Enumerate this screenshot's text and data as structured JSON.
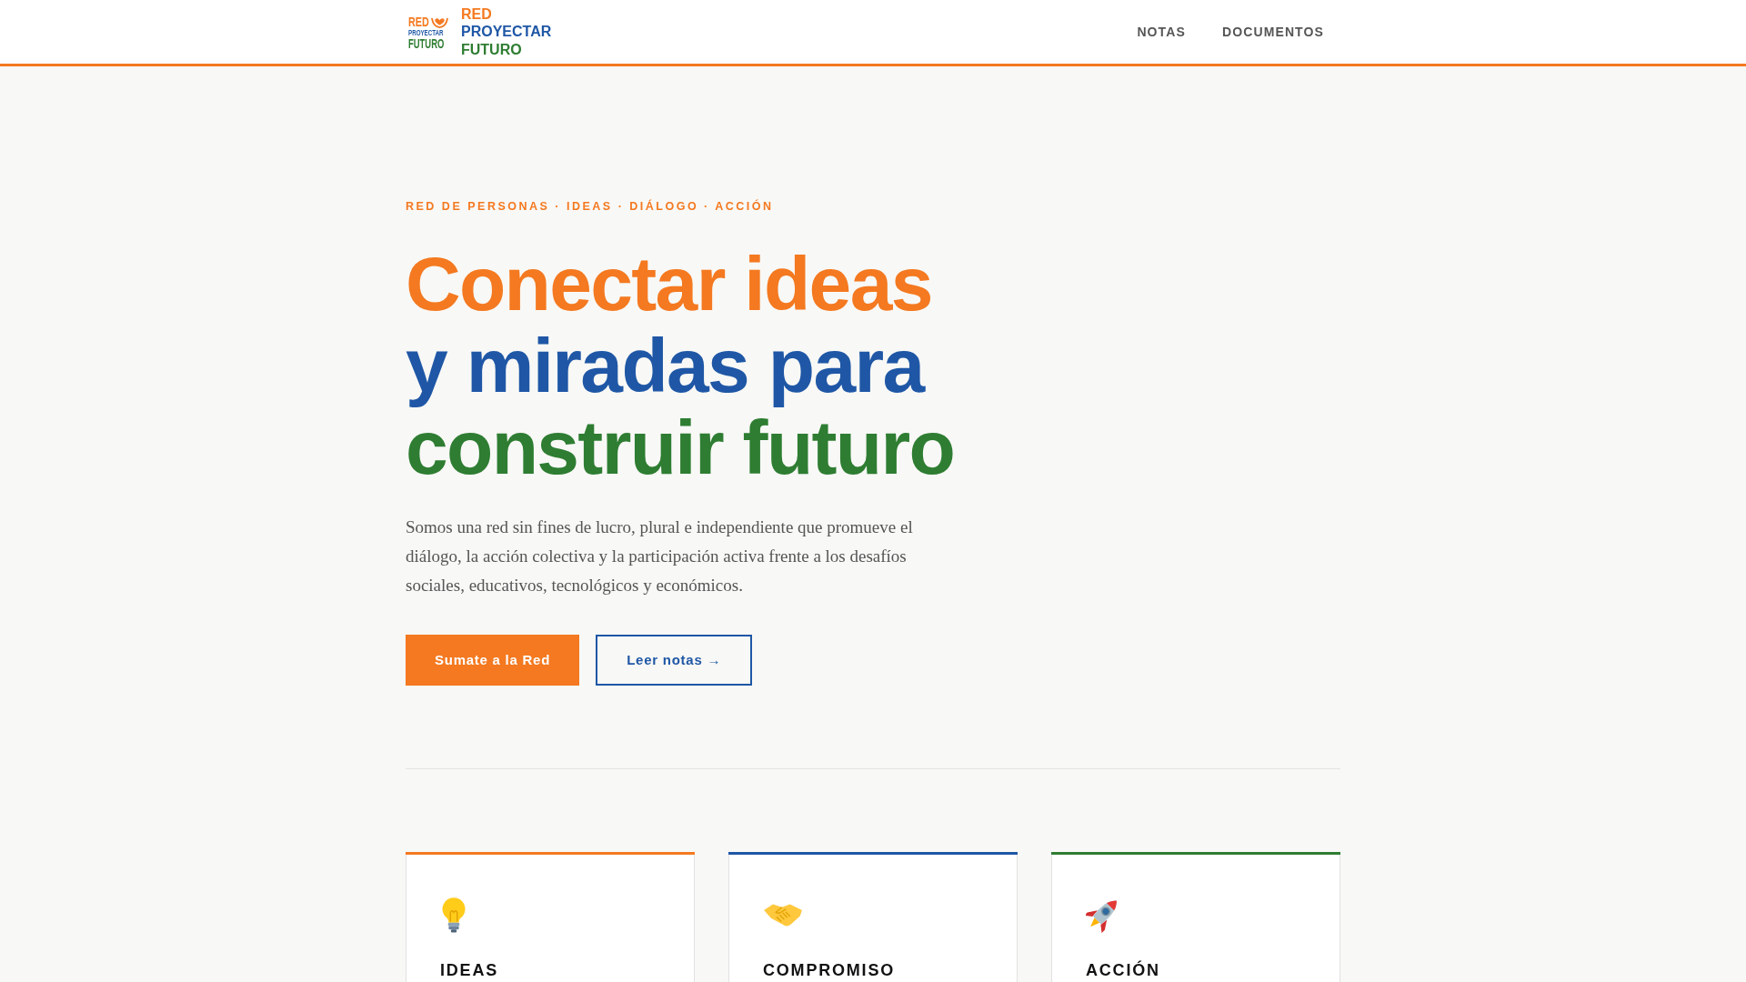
{
  "header": {
    "logo_emblem": [
      {
        "text": "RED",
        "color": "#f47920"
      },
      {
        "text": "PROYECTAR",
        "color": "#1f57a6"
      },
      {
        "text": "FUTURO",
        "color": "#2e7d32"
      }
    ],
    "logo_wordmark": [
      {
        "text": "RED",
        "color": "#f47920"
      },
      {
        "text": "PROYECTAR",
        "color": "#1f57a6"
      },
      {
        "text": "FUTURO",
        "color": "#2e7d32"
      }
    ],
    "nav": [
      "NOTAS",
      "DOCUMENTOS"
    ]
  },
  "hero": {
    "eyebrow": "RED DE PERSONAS · IDEAS · DIÁLOGO · ACCIÓN",
    "heading_lines": [
      {
        "text": "Conectar ideas",
        "color": "#f47920"
      },
      {
        "text": "y miradas para",
        "color": "#1f57a6"
      },
      {
        "text": "construir futuro",
        "color": "#2e7d32"
      }
    ],
    "description": "Somos una red sin fines de lucro, plural e independiente que promueve el diálogo, la acción colectiva y la participación activa frente a los desafíos sociales, educativos, tecnológicos y económicos.",
    "buttons": [
      {
        "label": "Sumate a la Red",
        "kind": "primary"
      },
      {
        "label": "Leer notas →",
        "kind": "outline"
      }
    ]
  },
  "cards": [
    {
      "title": "IDEAS",
      "color": "#f47920"
    },
    {
      "title": "COMPROMISO",
      "color": "#1f57a6"
    },
    {
      "title": "ACCIÓN",
      "color": "#2e7d32"
    }
  ]
}
